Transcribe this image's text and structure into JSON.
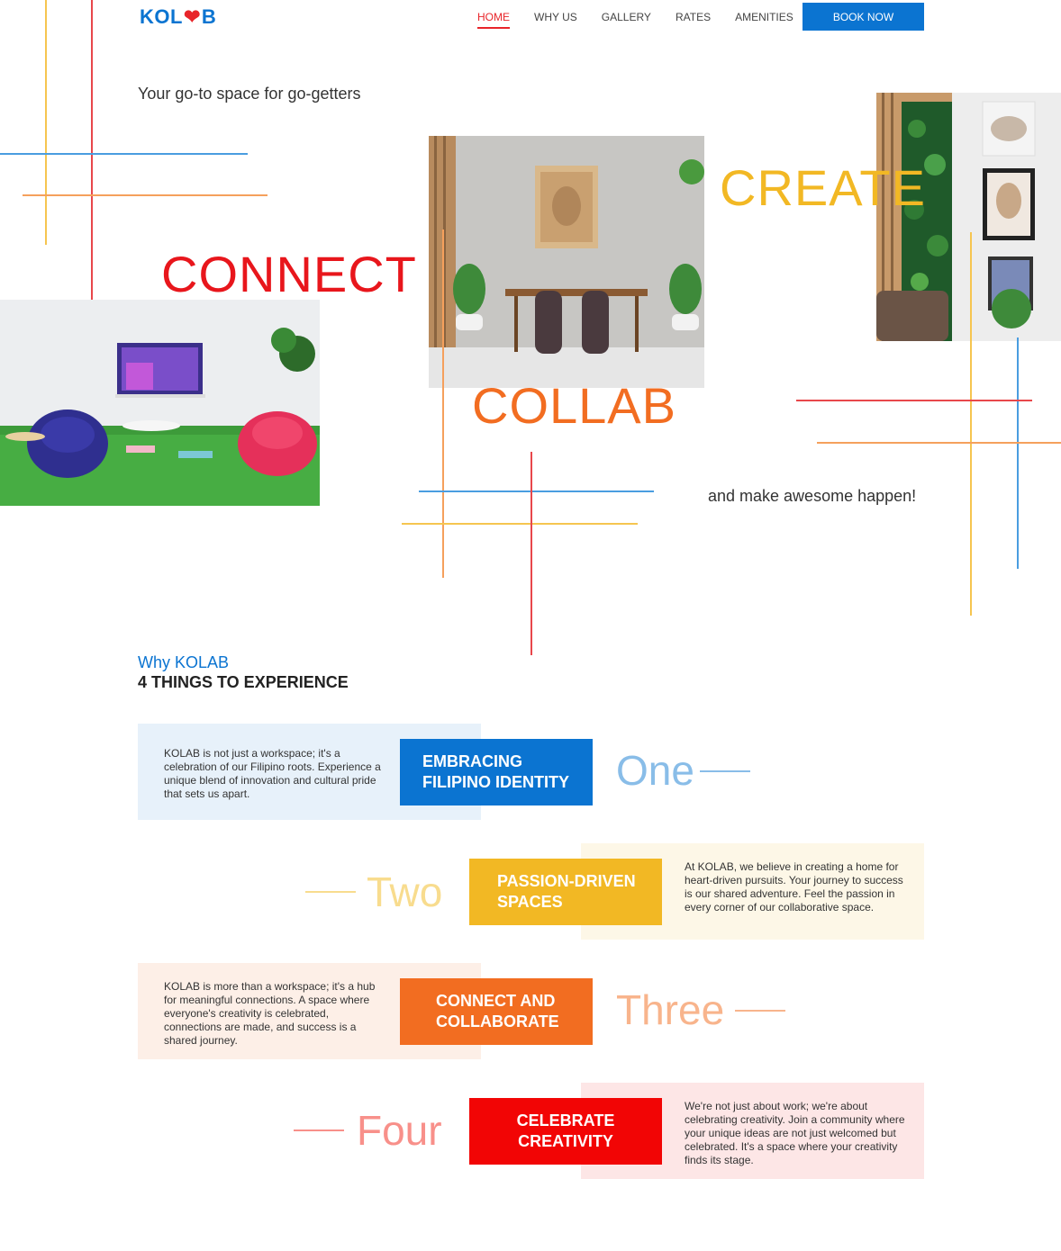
{
  "brand": {
    "logo_left": "KOL",
    "logo_heart": "❤",
    "logo_right": "B"
  },
  "nav": {
    "items": [
      "HOME",
      "WHY US",
      "GALLERY",
      "RATES",
      "AMENITIES"
    ],
    "book_label": "BOOK NOW"
  },
  "hero": {
    "tagline": "Your go-to space for go-getters",
    "word_connect": "CONNECT",
    "word_create": "CREATE",
    "word_collab": "COLLAB",
    "closing": "and make awesome happen!"
  },
  "why": {
    "label": "Why KOLAB",
    "title": "4 THINGS TO EXPERIENCE",
    "items": [
      {
        "number": "One",
        "title_1": "EMBRACING",
        "title_2": "FILIPINO IDENTITY",
        "color": "#0b74d1",
        "text": "KOLAB is not just a workspace; it's a celebration of our Filipino roots. Experience a unique blend of innovation and cultural pride that sets us apart."
      },
      {
        "number": "Two",
        "title_1": "PASSION-DRIVEN",
        "title_2": "SPACES",
        "color": "#f2b824",
        "text": "At KOLAB, we believe in creating a home for heart-driven pursuits. Your journey to success is our shared adventure. Feel the passion in every corner of our collaborative space."
      },
      {
        "number": "Three",
        "title_1": "CONNECT AND",
        "title_2": "COLLABORATE",
        "color": "#f26d21",
        "text": "KOLAB is more than a workspace; it's a hub for meaningful connections.  A space where everyone's creativity is celebrated, connections are made, and success is a shared journey."
      },
      {
        "number": "Four",
        "title_1": "CELEBRATE",
        "title_2": "CREATIVITY",
        "color": "#f20505",
        "text": "We're not just about work; we're about celebrating creativity. Join a community where your unique ideas are not just welcomed but celebrated. It's a space where your creativity finds its stage."
      }
    ]
  },
  "colors": {
    "blue": "#0b74d1",
    "red": "#e8161c",
    "yellow": "#f2b824",
    "orange": "#f26d21"
  }
}
